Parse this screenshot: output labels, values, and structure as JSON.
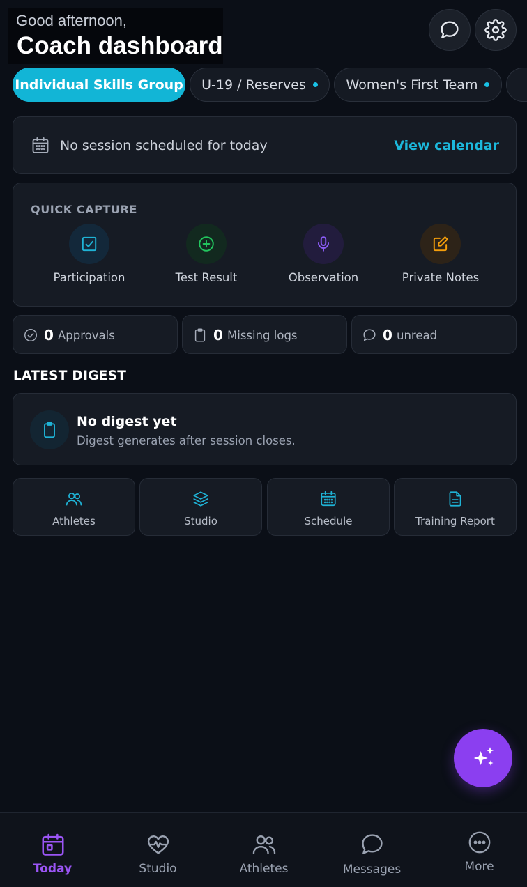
{
  "header": {
    "greeting": "Good afternoon,",
    "title": "Coach dashboard",
    "messages_icon": "chat-bubble-icon",
    "settings_icon": "gear-icon"
  },
  "tabs": [
    {
      "label": "Individual Skills Group",
      "active": true,
      "dot": false
    },
    {
      "label": "U-19 / Reserves",
      "active": false,
      "dot": true
    },
    {
      "label": "Women's First Team",
      "active": false,
      "dot": true
    }
  ],
  "session": {
    "text": "No session scheduled for today",
    "link": "View calendar"
  },
  "quick_capture": {
    "title": "QUICK CAPTURE",
    "items": [
      {
        "label": "Participation",
        "icon": "checkbox-icon",
        "color": "#1fb3d6"
      },
      {
        "label": "Test Result",
        "icon": "plus-circle-icon",
        "color": "#22c55e"
      },
      {
        "label": "Observation",
        "icon": "microphone-icon",
        "color": "#8b5cf6"
      },
      {
        "label": "Private Notes",
        "icon": "edit-icon",
        "color": "#f59e0b"
      }
    ]
  },
  "stats": [
    {
      "count": "0",
      "label": "Approvals",
      "icon": "check-circle-icon"
    },
    {
      "count": "0",
      "label": "Missing logs",
      "icon": "clipboard-icon"
    },
    {
      "count": "0",
      "label": "unread",
      "icon": "chat-bubble-icon"
    }
  ],
  "digest": {
    "section_title": "LATEST DIGEST",
    "title": "No digest yet",
    "subtitle": "Digest generates after session closes."
  },
  "shortcuts": [
    {
      "label": "Athletes",
      "icon": "users-icon"
    },
    {
      "label": "Studio",
      "icon": "layers-icon"
    },
    {
      "label": "Schedule",
      "icon": "calendar-icon"
    },
    {
      "label": "Training Report",
      "icon": "document-icon"
    }
  ],
  "fab": {
    "icon": "sparkles-icon",
    "color": "#8b3ff0"
  },
  "bottom_nav": [
    {
      "label": "Today",
      "icon": "calendar-icon",
      "active": true
    },
    {
      "label": "Studio",
      "icon": "heart-pulse-icon",
      "active": false
    },
    {
      "label": "Athletes",
      "icon": "users-icon",
      "active": false
    },
    {
      "label": "Messages",
      "icon": "chat-bubble-icon",
      "active": false
    },
    {
      "label": "More",
      "icon": "more-icon",
      "active": false
    }
  ],
  "colors": {
    "accent": "#12b5d6",
    "primary": "#8b3ff0",
    "background": "#0b0f17",
    "card": "#161b24"
  }
}
